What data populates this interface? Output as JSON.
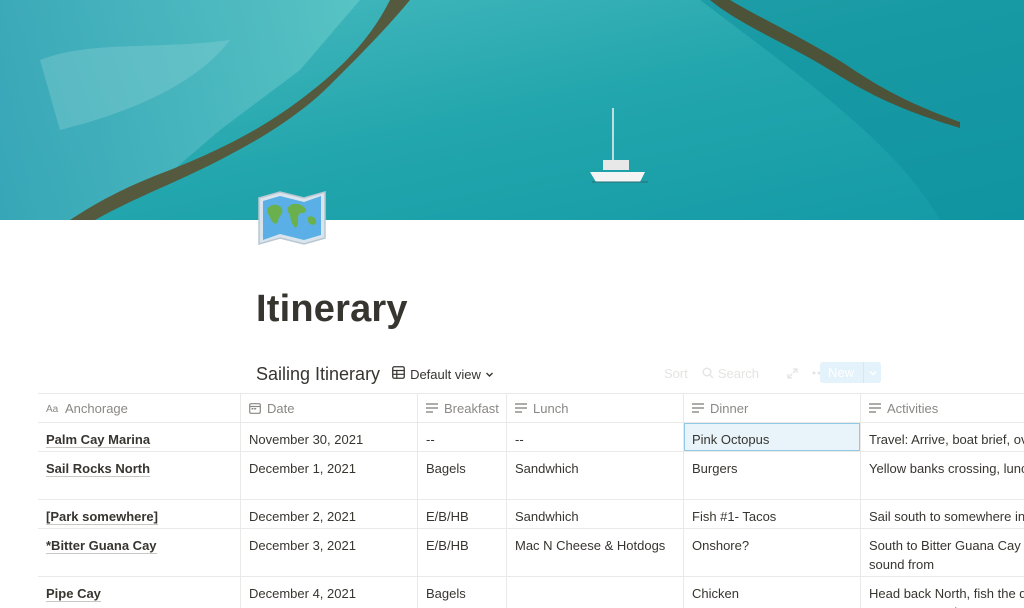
{
  "page": {
    "title": "Itinerary",
    "icon": "world-map-icon"
  },
  "database": {
    "title": "Sailing Itinerary",
    "view_label": "Default view",
    "tools": {
      "sort": "Sort",
      "search": "Search",
      "new": "New"
    }
  },
  "columns": [
    {
      "label": "Anchorage",
      "icon": "title-text-icon"
    },
    {
      "label": "Date",
      "icon": "calendar-icon"
    },
    {
      "label": "Breakfast",
      "icon": "text-lines-icon"
    },
    {
      "label": "Lunch",
      "icon": "text-lines-icon"
    },
    {
      "label": "Dinner",
      "icon": "text-lines-icon"
    },
    {
      "label": "Activities",
      "icon": "text-lines-icon"
    }
  ],
  "rows": [
    {
      "anchorage": "Palm Cay Marina",
      "date": "November 30, 2021",
      "breakfast": "--",
      "lunch": "--",
      "dinner": "Pink Octopus",
      "activities": "Travel: Arrive, boat brief, over"
    },
    {
      "anchorage": "Sail Rocks North",
      "date": "December 1, 2021",
      "breakfast": "Bagels",
      "lunch": "Sandwhich",
      "dinner": "Burgers",
      "activities": "Yellow banks crossing, lunch fishing/lobstering"
    },
    {
      "anchorage": "[Park somewhere]",
      "date": "December 2, 2021",
      "breakfast": "E/B/HB",
      "lunch": "Sandwhich",
      "dinner": "Fish #1- Tacos",
      "activities": "Sail south to somewhere in th"
    },
    {
      "anchorage": "*Bitter Guana Cay",
      "date": "December 3, 2021",
      "breakfast": "E/B/HB",
      "lunch": "Mac N Cheese & Hotdogs",
      "dinner": "Onshore?",
      "activities": "South to Bitter Guana Cay (fis Iguanas? Fish the sound from"
    },
    {
      "anchorage": "Pipe Cay",
      "date": "December 4, 2021",
      "breakfast": "Bagels",
      "lunch": "",
      "dinner": "Chicken",
      "activities": "Head back North, fish the dro beach day at Crescent Beach"
    }
  ]
}
